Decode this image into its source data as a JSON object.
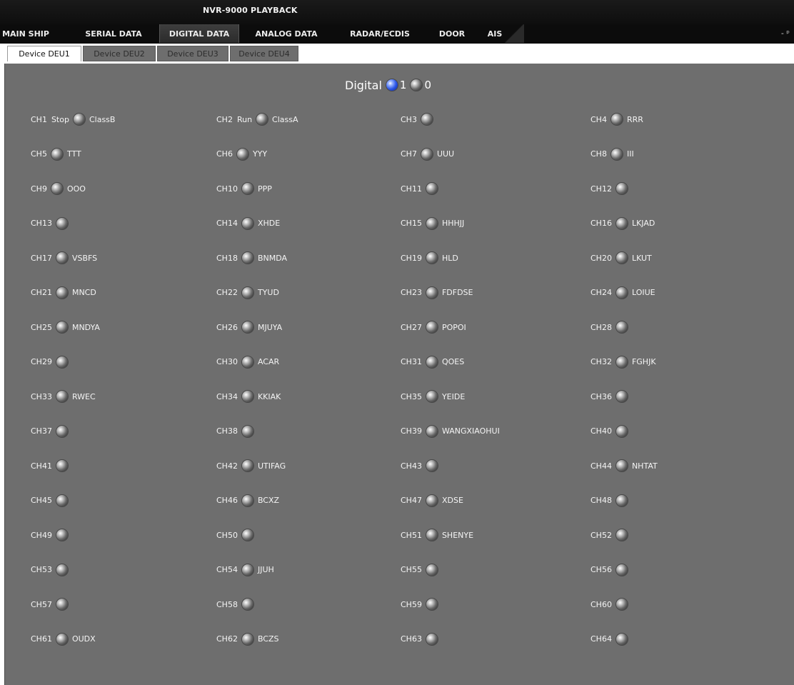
{
  "window": {
    "title": "NVR-9000 PLAYBACK"
  },
  "tabs": [
    {
      "label": "MAIN SHIP",
      "active": false
    },
    {
      "label": "SERIAL DATA",
      "active": false
    },
    {
      "label": "DIGITAL DATA",
      "active": true
    },
    {
      "label": "ANALOG DATA",
      "active": false
    },
    {
      "label": "RADAR/ECDIS",
      "active": false
    },
    {
      "label": "DOOR",
      "active": false
    },
    {
      "label": "AIS",
      "active": false
    }
  ],
  "pin_glyph": "- ᵖ",
  "devices": [
    {
      "label": "Device DEU1",
      "active": true
    },
    {
      "label": "Device DEU2",
      "active": false
    },
    {
      "label": "Device DEU3",
      "active": false
    },
    {
      "label": "Device DEU4",
      "active": false
    }
  ],
  "legend": {
    "label": "Digital",
    "on_value": "1",
    "off_value": "0",
    "on_color": "#2a55e8",
    "off_color": "#6a6a6a"
  },
  "channels": [
    {
      "code": "CH1",
      "state0": "Stop",
      "name": "ClassB"
    },
    {
      "code": "CH2",
      "state0": "Run",
      "name": "ClassA"
    },
    {
      "code": "CH3",
      "state0": "",
      "name": ""
    },
    {
      "code": "CH4",
      "state0": "",
      "name": "RRR"
    },
    {
      "code": "CH5",
      "state0": "",
      "name": "TTT"
    },
    {
      "code": "CH6",
      "state0": "",
      "name": "YYY"
    },
    {
      "code": "CH7",
      "state0": "",
      "name": "UUU"
    },
    {
      "code": "CH8",
      "state0": "",
      "name": "III"
    },
    {
      "code": "CH9",
      "state0": "",
      "name": "OOO"
    },
    {
      "code": "CH10",
      "state0": "",
      "name": "PPP"
    },
    {
      "code": "CH11",
      "state0": "",
      "name": ""
    },
    {
      "code": "CH12",
      "state0": "",
      "name": ""
    },
    {
      "code": "CH13",
      "state0": "",
      "name": ""
    },
    {
      "code": "CH14",
      "state0": "",
      "name": "XHDE"
    },
    {
      "code": "CH15",
      "state0": "",
      "name": "HHHJJ"
    },
    {
      "code": "CH16",
      "state0": "",
      "name": "LKJAD"
    },
    {
      "code": "CH17",
      "state0": "",
      "name": "VSBFS"
    },
    {
      "code": "CH18",
      "state0": "",
      "name": "BNMDA"
    },
    {
      "code": "CH19",
      "state0": "",
      "name": "HLD"
    },
    {
      "code": "CH20",
      "state0": "",
      "name": "LKUT"
    },
    {
      "code": "CH21",
      "state0": "",
      "name": "MNCD"
    },
    {
      "code": "CH22",
      "state0": "",
      "name": "TYUD"
    },
    {
      "code": "CH23",
      "state0": "",
      "name": "FDFDSE"
    },
    {
      "code": "CH24",
      "state0": "",
      "name": "LOIUE"
    },
    {
      "code": "CH25",
      "state0": "",
      "name": "MNDYA"
    },
    {
      "code": "CH26",
      "state0": "",
      "name": "MJUYA"
    },
    {
      "code": "CH27",
      "state0": "",
      "name": "POPOI"
    },
    {
      "code": "CH28",
      "state0": "",
      "name": ""
    },
    {
      "code": "CH29",
      "state0": "",
      "name": ""
    },
    {
      "code": "CH30",
      "state0": "",
      "name": "ACAR"
    },
    {
      "code": "CH31",
      "state0": "",
      "name": "QOES"
    },
    {
      "code": "CH32",
      "state0": "",
      "name": "FGHJK"
    },
    {
      "code": "CH33",
      "state0": "",
      "name": "RWEC"
    },
    {
      "code": "CH34",
      "state0": "",
      "name": "KKIAK"
    },
    {
      "code": "CH35",
      "state0": "",
      "name": "YEIDE"
    },
    {
      "code": "CH36",
      "state0": "",
      "name": ""
    },
    {
      "code": "CH37",
      "state0": "",
      "name": ""
    },
    {
      "code": "CH38",
      "state0": "",
      "name": ""
    },
    {
      "code": "CH39",
      "state0": "",
      "name": "WANGXIAOHUI"
    },
    {
      "code": "CH40",
      "state0": "",
      "name": ""
    },
    {
      "code": "CH41",
      "state0": "",
      "name": ""
    },
    {
      "code": "CH42",
      "state0": "",
      "name": "UTIFAG"
    },
    {
      "code": "CH43",
      "state0": "",
      "name": ""
    },
    {
      "code": "CH44",
      "state0": "",
      "name": "NHTAT"
    },
    {
      "code": "CH45",
      "state0": "",
      "name": ""
    },
    {
      "code": "CH46",
      "state0": "",
      "name": "BCXZ"
    },
    {
      "code": "CH47",
      "state0": "",
      "name": "XDSE"
    },
    {
      "code": "CH48",
      "state0": "",
      "name": ""
    },
    {
      "code": "CH49",
      "state0": "",
      "name": ""
    },
    {
      "code": "CH50",
      "state0": "",
      "name": ""
    },
    {
      "code": "CH51",
      "state0": "",
      "name": "SHENYE"
    },
    {
      "code": "CH52",
      "state0": "",
      "name": ""
    },
    {
      "code": "CH53",
      "state0": "",
      "name": ""
    },
    {
      "code": "CH54",
      "state0": "",
      "name": "JJUH"
    },
    {
      "code": "CH55",
      "state0": "",
      "name": ""
    },
    {
      "code": "CH56",
      "state0": "",
      "name": ""
    },
    {
      "code": "CH57",
      "state0": "",
      "name": ""
    },
    {
      "code": "CH58",
      "state0": "",
      "name": ""
    },
    {
      "code": "CH59",
      "state0": "",
      "name": ""
    },
    {
      "code": "CH60",
      "state0": "",
      "name": ""
    },
    {
      "code": "CH61",
      "state0": "",
      "name": "OUDX"
    },
    {
      "code": "CH62",
      "state0": "",
      "name": "BCZS"
    },
    {
      "code": "CH63",
      "state0": "",
      "name": ""
    },
    {
      "code": "CH64",
      "state0": "",
      "name": ""
    }
  ]
}
